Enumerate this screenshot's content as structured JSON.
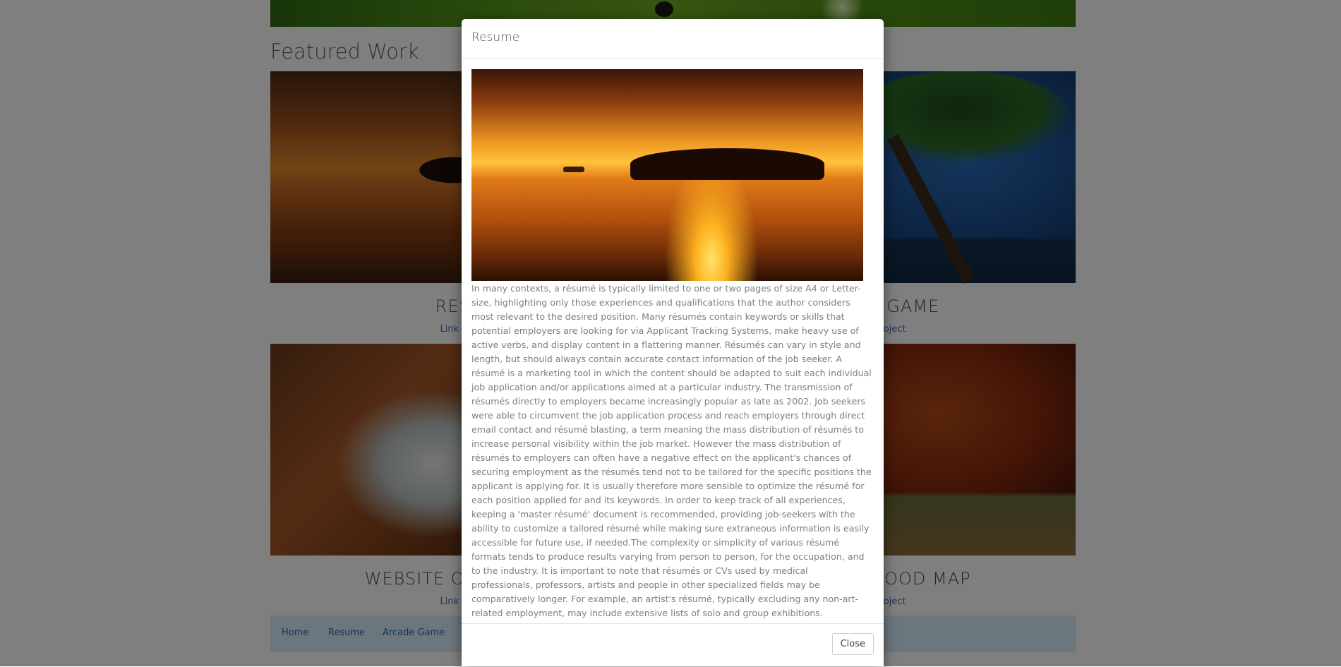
{
  "section_title": "Featured Work",
  "cards": [
    {
      "title": "RESUME",
      "link": "Link to project"
    },
    {
      "title": "ARCADE GAME",
      "link": "Link to project"
    },
    {
      "title": "WEBSITE OPTIMIZATION",
      "link": "Link to project"
    },
    {
      "title": "NEIGHBORHOOD MAP",
      "link": "Link to project"
    }
  ],
  "navbar": {
    "items": [
      "Home",
      "Resume",
      "Arcade Game"
    ]
  },
  "modal": {
    "title": "Resume",
    "body": "In many contexts, a résumé is typically limited to one or two pages of size A4 or Letter-size, highlighting only those experiences and qualifications that the author considers most relevant to the desired position. Many résumés contain keywords or skills that potential employers are looking for via Applicant Tracking Systems, make heavy use of active verbs, and display content in a flattering manner. Résumés can vary in style and length, but should always contain accurate contact information of the job seeker. A résumé is a marketing tool in which the content should be adapted to suit each individual job application and/or applications aimed at a particular industry. The transmission of résumés directly to employers became increasingly popular as late as 2002. Job seekers were able to circumvent the job application process and reach employers through direct email contact and résumé blasting, a term meaning the mass distribution of résumés to increase personal visibility within the job market. However the mass distribution of résumés to employers can often have a negative effect on the applicant's chances of securing employment as the résumés tend not to be tailored for the specific positions the applicant is applying for. It is usually therefore more sensible to optimize the résumé for each position applied for and its keywords. In order to keep track of all experiences, keeping a 'master résumé' document is recommended, providing job-seekers with the ability to customize a tailored résumé while making sure extraneous information is easily accessible for future use, if needed.The complexity or simplicity of various résumé formats tends to produce results varying from person to person, for the occupation, and to the industry. It is important to note that résumés or CVs used by medical professionals, professors, artists and people in other specialized fields may be comparatively longer. For example, an artist's résumé, typically excluding any non-art-related employment, may include extensive lists of solo and group exhibitions.",
    "close_label": "Close"
  }
}
